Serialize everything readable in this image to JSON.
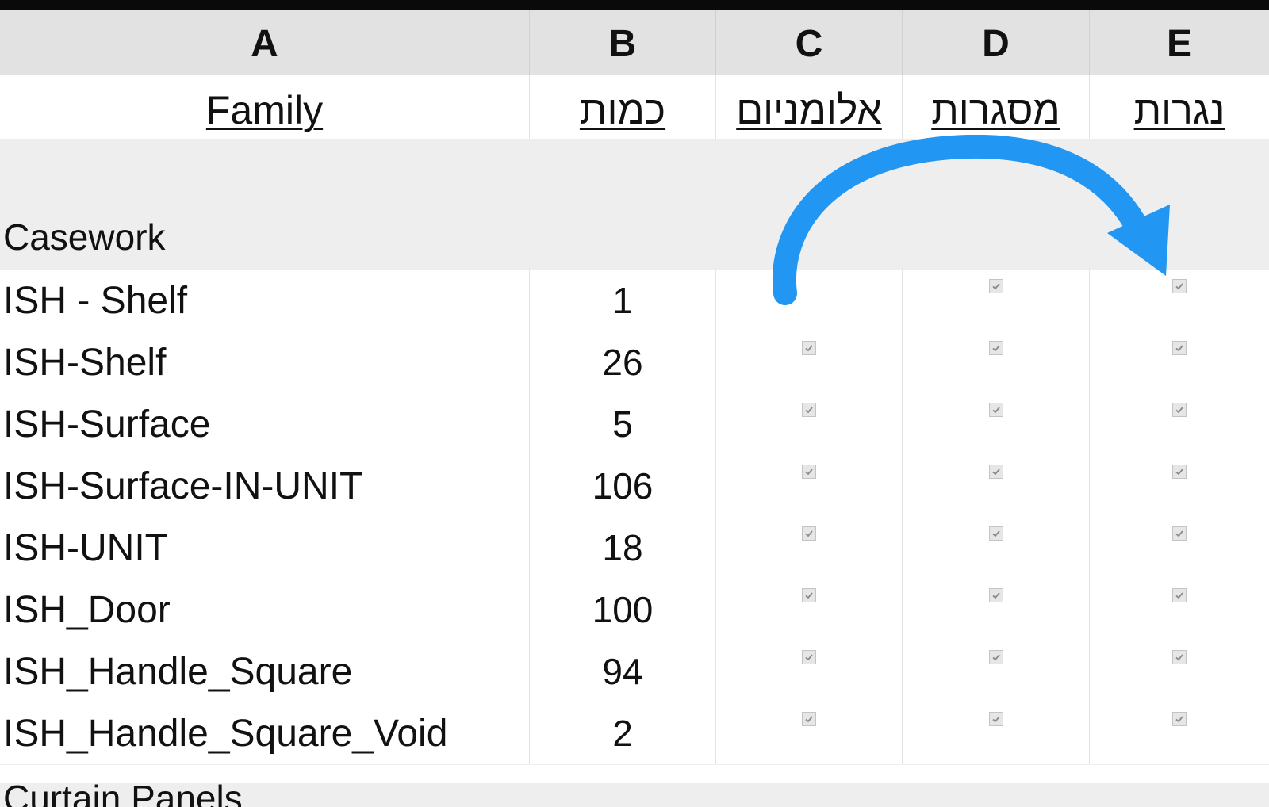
{
  "columns": {
    "letters": [
      "A",
      "B",
      "C",
      "D",
      "E"
    ]
  },
  "headers": {
    "family": "Family",
    "quantity": "כמות",
    "aluminum": "אלומניום",
    "frames": "מסגרות",
    "carpentry": "נגרות"
  },
  "groups": [
    {
      "label": "Casework"
    },
    {
      "label": "Curtain Panels"
    }
  ],
  "rows": [
    {
      "family": "ISH - Shelf",
      "qty": "1",
      "c": false,
      "d": true,
      "e": true
    },
    {
      "family": "ISH-Shelf",
      "qty": "26",
      "c": true,
      "d": true,
      "e": true
    },
    {
      "family": "ISH-Surface",
      "qty": "5",
      "c": true,
      "d": true,
      "e": true
    },
    {
      "family": "ISH-Surface-IN-UNIT",
      "qty": "106",
      "c": true,
      "d": true,
      "e": true
    },
    {
      "family": "ISH-UNIT",
      "qty": "18",
      "c": true,
      "d": true,
      "e": true
    },
    {
      "family": "ISH_Door",
      "qty": "100",
      "c": true,
      "d": true,
      "e": true
    },
    {
      "family": "ISH_Handle_Square",
      "qty": "94",
      "c": true,
      "d": true,
      "e": true
    },
    {
      "family": "ISH_Handle_Square_Void",
      "qty": "2",
      "c": true,
      "d": true,
      "e": true
    }
  ],
  "annotation": {
    "icon": "curved-arrow-icon",
    "color": "#2196f3"
  },
  "colors": {
    "header_bg": "#e2e2e2",
    "group_bg": "#eeeeee",
    "checkbox_bg": "#e6e6e6"
  }
}
